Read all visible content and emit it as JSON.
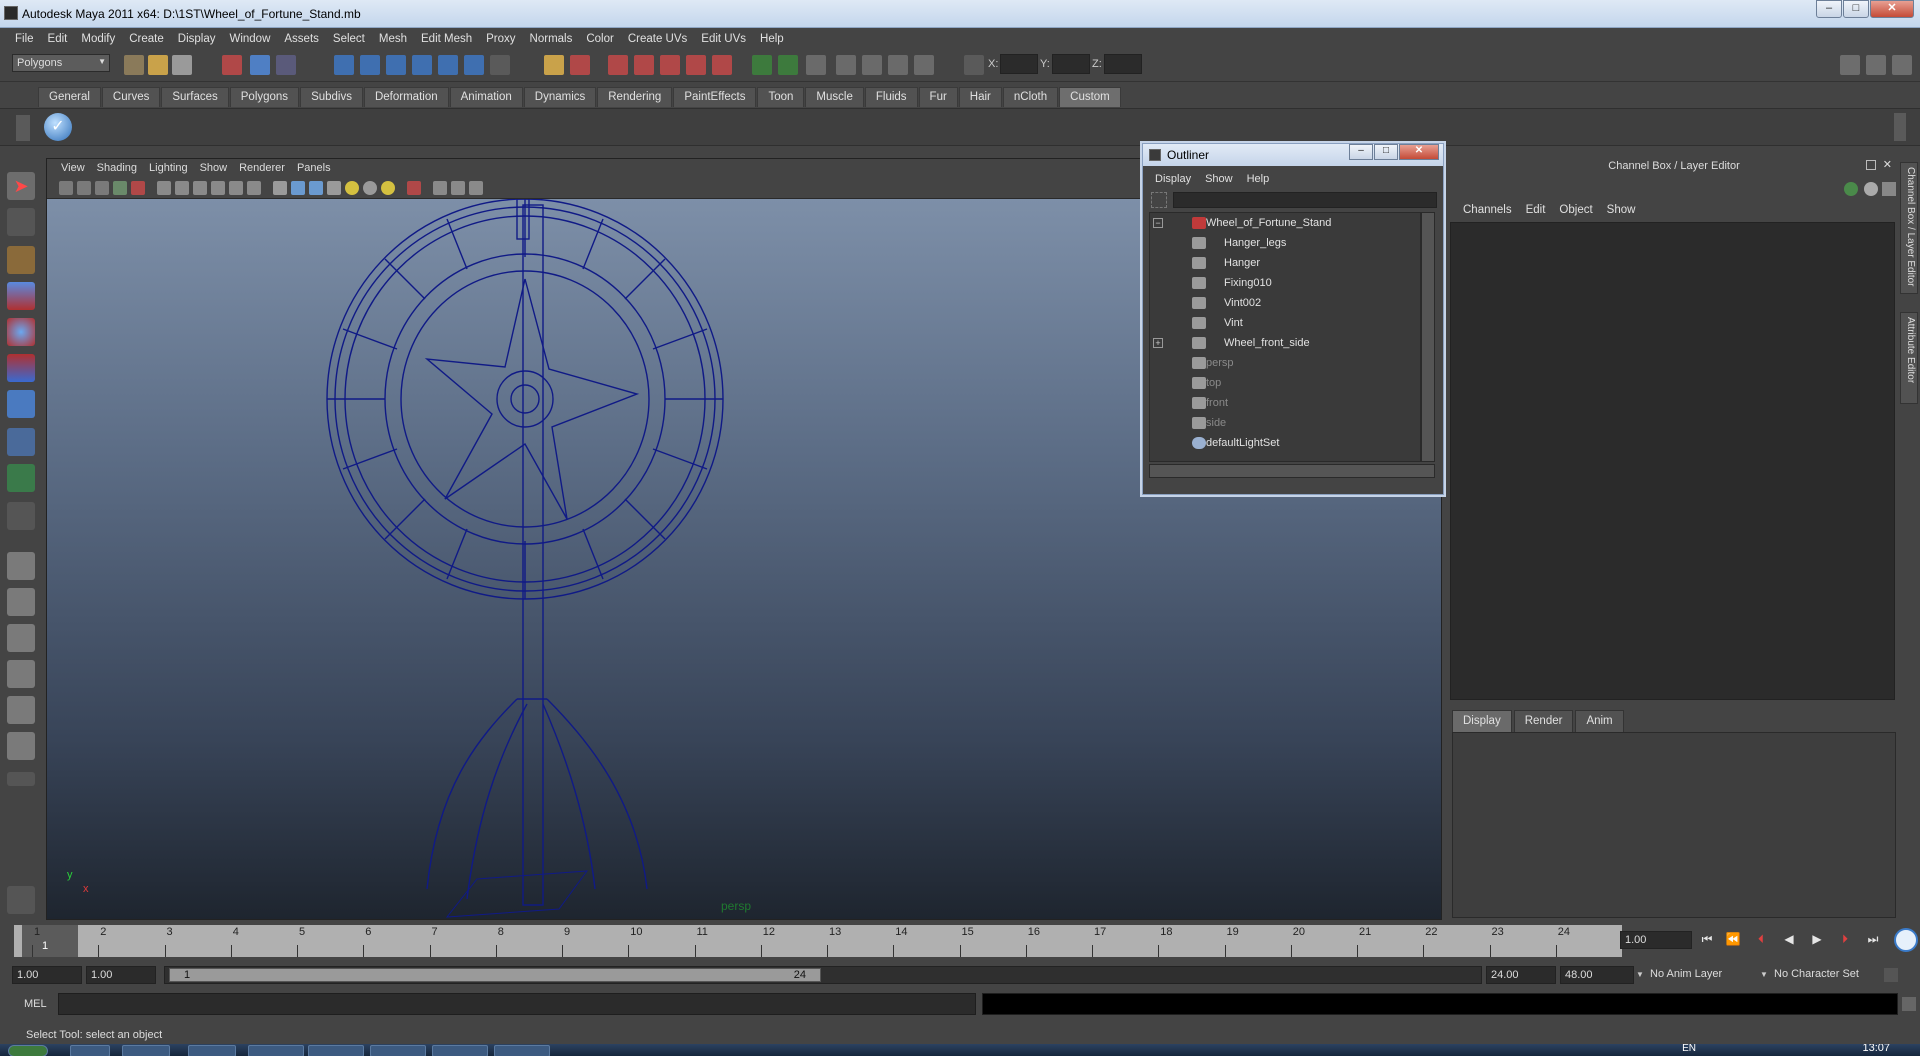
{
  "window": {
    "title": "Autodesk Maya 2011 x64: D:\\1ST\\Wheel_of_Fortune_Stand.mb",
    "minimize": "–",
    "maximize": "□",
    "close": "✕"
  },
  "menubar": [
    "File",
    "Edit",
    "Modify",
    "Create",
    "Display",
    "Window",
    "Assets",
    "Select",
    "Mesh",
    "Edit Mesh",
    "Proxy",
    "Normals",
    "Color",
    "Create UVs",
    "Edit UVs",
    "Help"
  ],
  "statusline": {
    "mode": "Polygons",
    "x_label": "X:",
    "y_label": "Y:",
    "z_label": "Z:"
  },
  "shelf_tabs": [
    "General",
    "Curves",
    "Surfaces",
    "Polygons",
    "Subdivs",
    "Deformation",
    "Animation",
    "Dynamics",
    "Rendering",
    "PaintEffects",
    "Toon",
    "Muscle",
    "Fluids",
    "Fur",
    "Hair",
    "nCloth",
    "Custom"
  ],
  "shelf_active": "Custom",
  "viewport": {
    "menus": [
      "View",
      "Shading",
      "Lighting",
      "Show",
      "Renderer",
      "Panels"
    ],
    "camera_label": "persp",
    "axis_y": "y",
    "axis_x": "x"
  },
  "outliner": {
    "title": "Outliner",
    "menus": [
      "Display",
      "Show",
      "Help"
    ],
    "items": [
      {
        "label": "Wheel_of_Fortune_Stand",
        "kind": "group",
        "dim": false
      },
      {
        "label": "Hanger_legs",
        "kind": "mesh",
        "dim": false
      },
      {
        "label": "Hanger",
        "kind": "mesh",
        "dim": false
      },
      {
        "label": "Fixing010",
        "kind": "mesh",
        "dim": false
      },
      {
        "label": "Vint002",
        "kind": "mesh",
        "dim": false
      },
      {
        "label": "Vint",
        "kind": "mesh",
        "dim": false
      },
      {
        "label": "Wheel_front_side",
        "kind": "mesh",
        "dim": false
      },
      {
        "label": "persp",
        "kind": "camera",
        "dim": true
      },
      {
        "label": "top",
        "kind": "camera",
        "dim": true
      },
      {
        "label": "front",
        "kind": "camera",
        "dim": true
      },
      {
        "label": "side",
        "kind": "camera",
        "dim": true
      },
      {
        "label": "defaultLightSet",
        "kind": "set",
        "dim": false
      }
    ]
  },
  "channelbox": {
    "title": "Channel Box / Layer Editor",
    "menus": [
      "Channels",
      "Edit",
      "Object",
      "Show"
    ]
  },
  "side_tabs": [
    "Channel Box / Layer Editor",
    "Attribute Editor"
  ],
  "layer_editor": {
    "tabs": [
      "Display",
      "Render",
      "Anim"
    ],
    "active": "Display"
  },
  "timeslider": {
    "ticks": [
      "1",
      "2",
      "3",
      "4",
      "5",
      "6",
      "7",
      "8",
      "9",
      "10",
      "11",
      "12",
      "13",
      "14",
      "15",
      "16",
      "17",
      "18",
      "19",
      "20",
      "21",
      "22",
      "23",
      "24"
    ],
    "current_marker": "1",
    "current_frame": "1.00"
  },
  "range": {
    "start_time": "1.00",
    "playback_start": "1.00",
    "handle_start": "1",
    "handle_end": "24",
    "playback_end": "24.00",
    "end_time": "48.00",
    "anim_layer": "No Anim Layer",
    "character_set": "No Character Set"
  },
  "cmdline": {
    "label": "MEL"
  },
  "helpline": "Select Tool: select an object",
  "taskbar": {
    "lang": "EN",
    "clock": "13:07"
  },
  "colors": {
    "wireframe": "#101a86",
    "accent": "#6a6a6a",
    "window_chrome": "#c5d5ea"
  }
}
